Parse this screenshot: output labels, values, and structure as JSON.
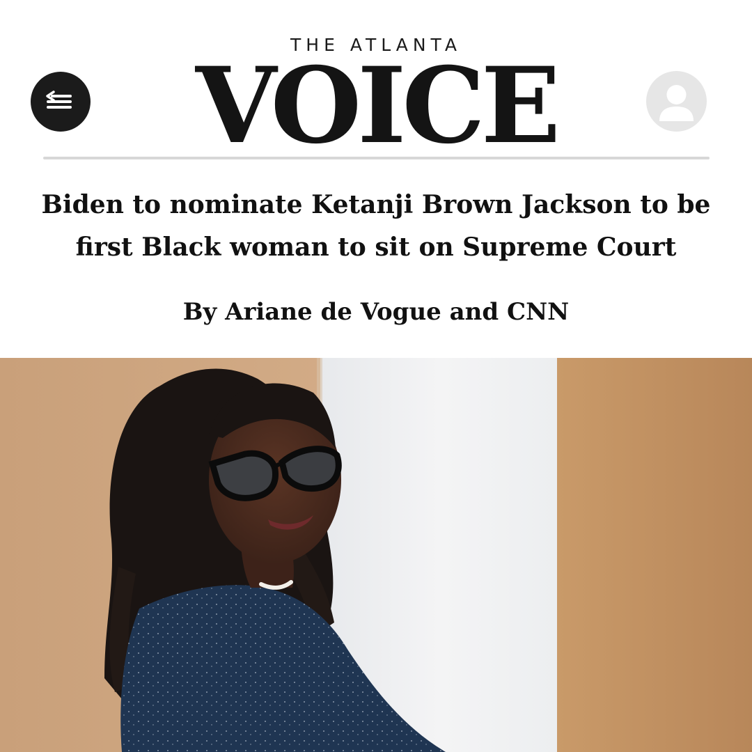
{
  "header": {
    "masthead_top": "THE ATLANTA",
    "masthead_main": "VOICE",
    "menu_icon": "menu-back-icon",
    "account_icon": "user-account-icon"
  },
  "article": {
    "headline": "Biden to nominate Ketanji Brown Jackson to be first Black woman to sit on Supreme Court",
    "byline": "By Ariane de Vogue and CNN"
  },
  "photo": {
    "subject": "portrait-photo"
  },
  "colors": {
    "ink": "#111111",
    "menu_bg": "#1b1b1b",
    "account_bg": "#e6e6e6",
    "divider": "#d7d7d7",
    "wall_left": "#c79a6e",
    "wall_center": "#f1f1f2",
    "wall_right": "#c0905f",
    "sweater": "#1f3552"
  }
}
